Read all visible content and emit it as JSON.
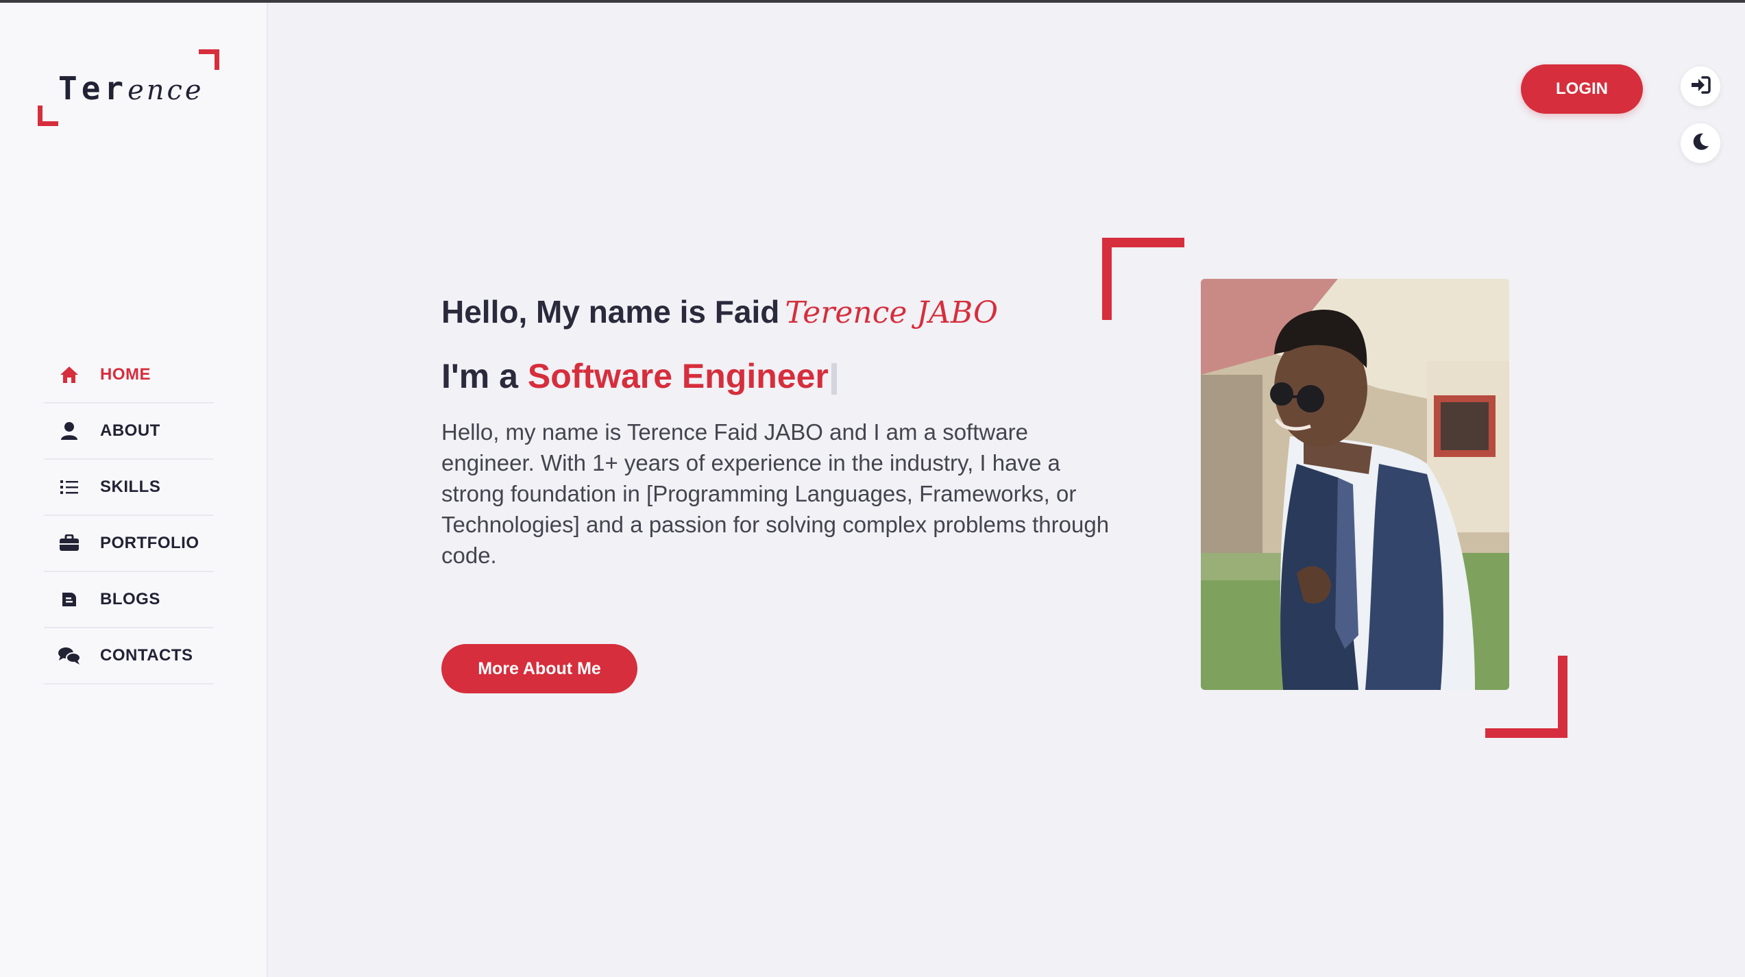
{
  "logo": {
    "bold": "Ter",
    "italic": "ence"
  },
  "nav": [
    {
      "label": "HOME",
      "icon": "home-icon",
      "active": true
    },
    {
      "label": "ABOUT",
      "icon": "user-icon",
      "active": false
    },
    {
      "label": "SKILLS",
      "icon": "list-icon",
      "active": false
    },
    {
      "label": "PORTFOLIO",
      "icon": "briefcase-icon",
      "active": false
    },
    {
      "label": "BLOGS",
      "icon": "blog-icon",
      "active": false
    },
    {
      "label": "CONTACTS",
      "icon": "chat-icon",
      "active": false
    }
  ],
  "header": {
    "login_label": "LOGIN"
  },
  "hero": {
    "greeting": "Hello, My name is Faid",
    "name_script": "Terence JABO",
    "role_prefix": "I'm a",
    "role": "Software Engineer",
    "description": "Hello, my name is Terence Faid JABO and I am a software engineer. With 1+ years of experience in the industry, I have a strong foundation in [Programming Languages, Frameworks, or Technologies] and a passion for solving complex problems through code.",
    "cta_label": "More About Me"
  },
  "colors": {
    "accent": "#d62e3c",
    "text": "#2a2a3c",
    "background": "#f1f1f6",
    "sidebar": "#f8f8fb"
  }
}
